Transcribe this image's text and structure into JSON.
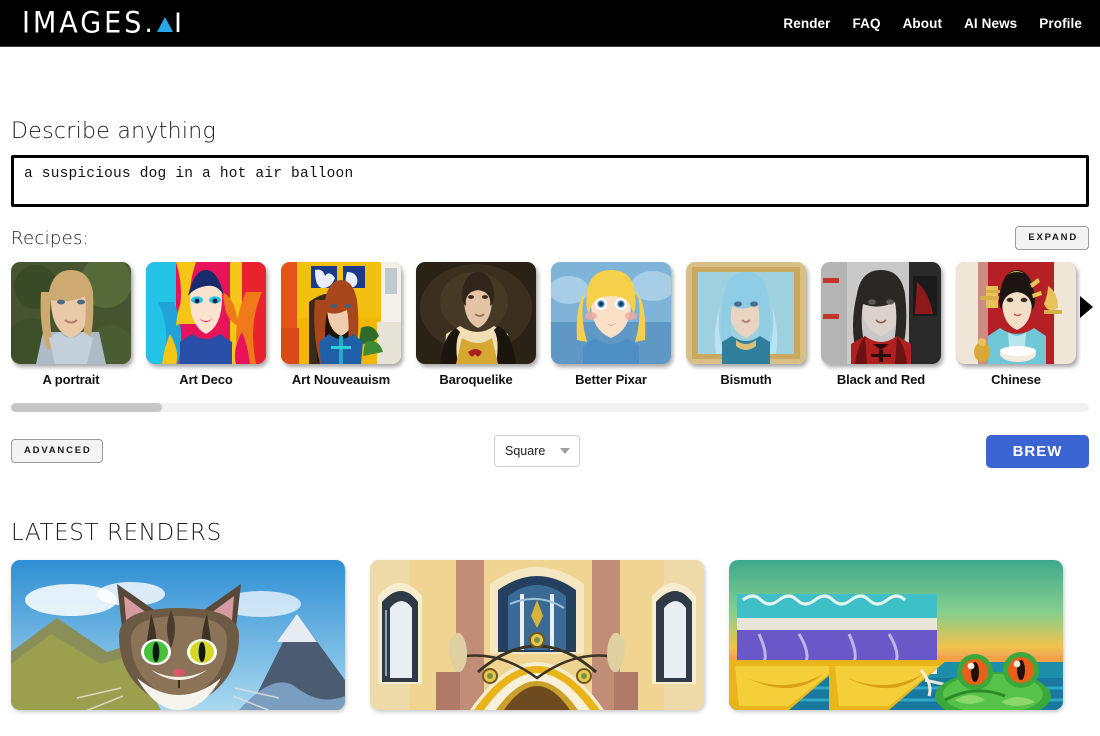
{
  "header": {
    "logo": {
      "text": "IMAGES",
      "dot": ".",
      "triangle_icon": "triangle-a-icon",
      "suffix": "I",
      "accent_color": "#2aa7e8"
    },
    "nav": [
      {
        "label": "Render"
      },
      {
        "label": "FAQ"
      },
      {
        "label": "About"
      },
      {
        "label": "AI News"
      },
      {
        "label": "Profile"
      }
    ]
  },
  "prompt": {
    "label": "Describe anything",
    "value": "a suspicious dog in a hot air balloon",
    "placeholder": "Describe anything"
  },
  "recipes": {
    "label": "Recipes:",
    "expand_label": "EXPAND",
    "items": [
      {
        "name": "A portrait"
      },
      {
        "name": "Art Deco"
      },
      {
        "name": "Art Nouveauism"
      },
      {
        "name": "Baroquelike"
      },
      {
        "name": "Better Pixar"
      },
      {
        "name": "Bismuth"
      },
      {
        "name": "Black and Red"
      },
      {
        "name": "Chinese"
      }
    ],
    "next_arrow_icon": "chevron-right-icon",
    "scroll_position_percent": 14
  },
  "controls": {
    "advanced_label": "ADVANCED",
    "aspect_ratio": {
      "value": "Square",
      "caret_icon": "chevron-down-icon"
    },
    "brew_label": "BREW",
    "brew_color": "#3a64d2"
  },
  "latest": {
    "title": "LATEST RENDERS",
    "renders": [
      {
        "caption": "cat-in-mountains"
      },
      {
        "caption": "art-nouveau-facade"
      },
      {
        "caption": "cocktails-with-frog"
      }
    ]
  }
}
